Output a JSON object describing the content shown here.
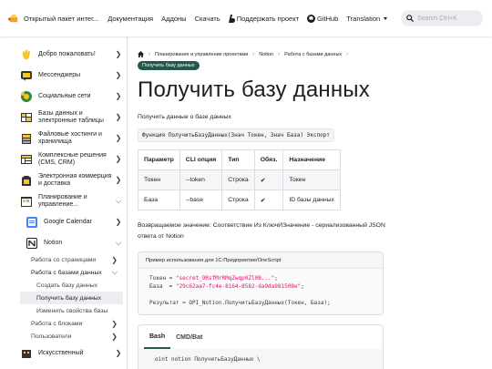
{
  "navbar": {
    "brand": "Открытый пакет интег...",
    "links": [
      "Документация",
      "Аддоны",
      "Скачать",
      "Поддержать проект",
      "GitHub",
      "Translation"
    ],
    "search_placeholder": "Search Ctrl+K"
  },
  "sidebar": {
    "items": [
      {
        "label": "Добро пожаловать!",
        "icon": "waving-hand-icon"
      },
      {
        "label": "Мессенджеры",
        "icon": "messenger-icon"
      },
      {
        "label": "Социальные сети",
        "icon": "social-icon"
      },
      {
        "label": "Базы данных и электронные таблицы",
        "icon": "database-icon"
      },
      {
        "label": "Файловые хостинги и хранилища",
        "icon": "cloud-storage-icon"
      },
      {
        "label": "Комплексные решения (CMS, CRM)",
        "icon": "cms-icon"
      },
      {
        "label": "Электронная коммерция и доставка",
        "icon": "ecommerce-icon"
      },
      {
        "label": "Планирование и управление...",
        "icon": "planning-icon"
      },
      {
        "label": "Google Calendar",
        "icon": "google-calendar-icon"
      },
      {
        "label": "Notion",
        "icon": "notion-icon"
      }
    ],
    "sub": [
      "Работа со страницами",
      "Работа с базами данных",
      "Создать базу данных",
      "Получить базу данных",
      "Изменить свойства базы",
      "Работа с блоками",
      "Пользователи",
      "Искусственный"
    ]
  },
  "breadcrumbs": [
    "Планирование и управление проектами",
    "Notion",
    "Работа с базами данных",
    "Получить базу данных"
  ],
  "page": {
    "title": "Получить базу данных",
    "description": "Получить данные о базе данных",
    "signature": "Функция ПолучитьБазуДанных(Знач Токен, Знач База) Экспорт",
    "table": {
      "headers": [
        "Параметр",
        "CLI опция",
        "Тип",
        "Обяз.",
        "Назначение"
      ],
      "rows": [
        [
          "Токен",
          "--token",
          "Строка",
          "✔",
          "Токен"
        ],
        [
          "База",
          "--base",
          "Строка",
          "✔",
          "ID базы данных"
        ]
      ]
    },
    "return_value": "Возвращаемое значение: Соответствие Из КлючИЗначение - сериализованный JSON ответа от Notion",
    "example": {
      "title": "Пример использования для 1С:Предприятие/OneScript",
      "line1_prefix": "Токен = ",
      "line1_value": "\"secret_9RsfMrRMqZwqp0Zl0B...\"",
      "line1_suffix": ";",
      "line2_prefix": "База  = ",
      "line2_value": "\"29c62aa7-fc4e-8164-8582-da9da981508e\"",
      "line2_suffix": ";",
      "line3": "Результат = OPI_Notion.ПолучитьБазуДанных(Токен, База);"
    },
    "tabs": [
      "Bash",
      "CMD/Bat"
    ],
    "bash_line": "oint notion ПолучитьБазуДанных \\"
  },
  "colors": {
    "accent": "#24584e",
    "string": "#e3116c",
    "sidebar_active_bg": "#ebedf0"
  }
}
